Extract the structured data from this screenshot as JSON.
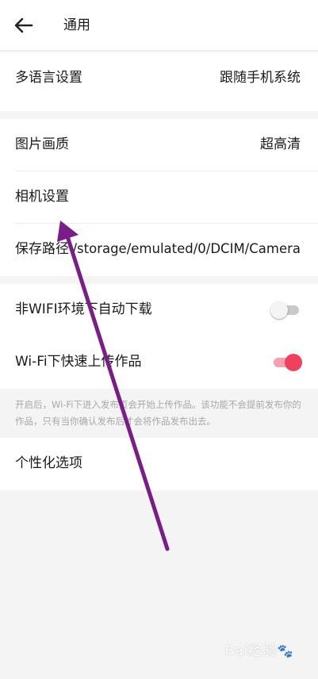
{
  "header": {
    "title": "通用"
  },
  "sections": {
    "language": {
      "label": "多语言设置",
      "value": "跟随手机系统"
    },
    "image_quality": {
      "label": "图片画质",
      "value": "超高清"
    },
    "camera": {
      "label": "相机设置"
    },
    "save_path": {
      "label": "保存路径",
      "value": "/storage/emulated/0/DCIM/Camera"
    },
    "auto_download": {
      "label": "非WIFI环境下自动下载",
      "enabled": false
    },
    "wifi_upload": {
      "label": "Wi-Fi下快速上传作品",
      "enabled": true
    },
    "note": "开启后，Wi-Fi下进入发布页会开始上传作品。该功能不会提前发布你的作品，只有当你确认发布后才会将作品发布出去。",
    "personalization": {
      "label": "个性化选项"
    }
  },
  "colors": {
    "accent": "#f0405d",
    "annotation_arrow": "#7a1d88"
  },
  "watermark": {
    "text": "Bai经验",
    "paw": "🐾"
  }
}
